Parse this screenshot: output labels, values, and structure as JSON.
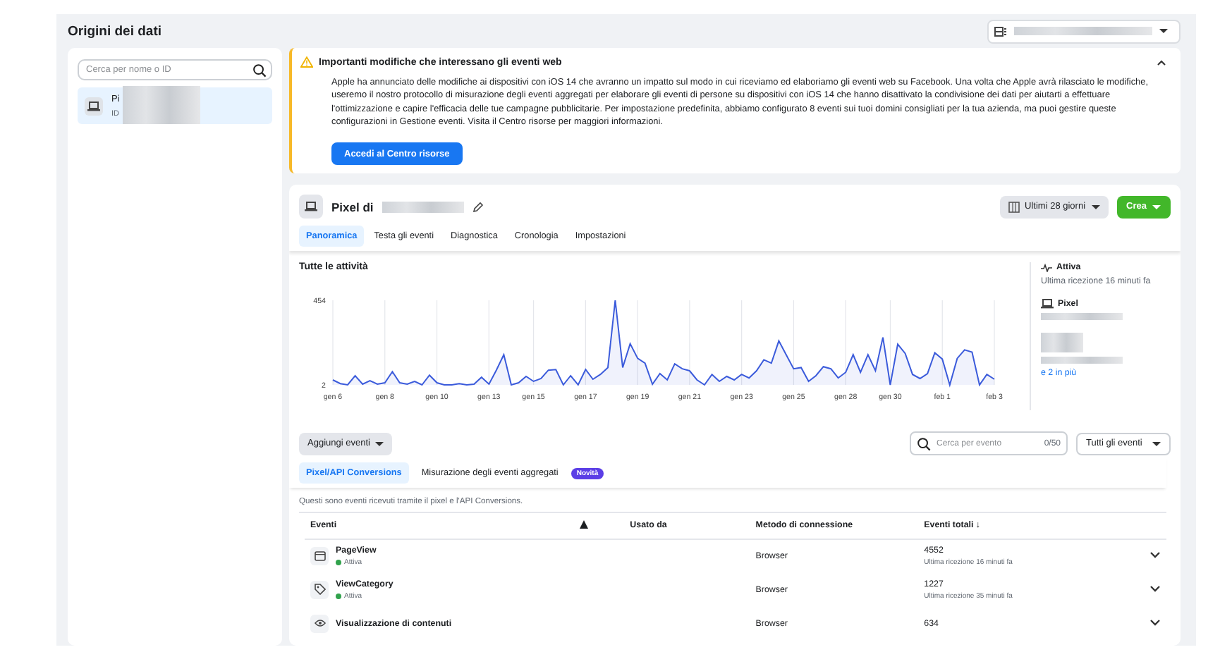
{
  "header": {
    "title": "Origini dei dati"
  },
  "sidebar": {
    "search": {
      "placeholder": "Cerca per nome o ID"
    },
    "items": [
      {
        "name": "Pi",
        "id": "ID",
        "selected": true
      }
    ]
  },
  "notice": {
    "title": "Importanti modifiche che interessano gli eventi web",
    "expanded": true,
    "body": "Apple ha annunciato delle modifiche ai dispositivi con iOS 14 che avranno un impatto sul modo in cui riceviamo ed elaboriamo gli eventi web su Facebook. Una volta che Apple avrà rilasciato le modifiche, useremo il nostro protocollo di misurazione degli eventi aggregati per elaborare gli eventi di persone su dispositivi con iOS 14 che hanno disattivato la condivisione dei dati per aiutarti a effettuare l'ottimizzazione e capire l'efficacia delle tue campagne pubblicitarie. Per impostazione predefinita, abbiamo configurato 8 eventi sui tuoi domini consigliati per la tua azienda, ma puoi gestire queste configurazioni in Gestione eventi. Visita il Centro risorse per maggiori informazioni.",
    "button": "Accedi al Centro risorse"
  },
  "pixel": {
    "title": "Pixel di",
    "date_range": "Ultimi 28 giorni",
    "create": "Crea",
    "tabs": [
      {
        "label": "Panoramica",
        "selected": true
      },
      {
        "label": "Testa gli eventi",
        "selected": false
      },
      {
        "label": "Diagnostica",
        "selected": false
      },
      {
        "label": "Cronologia",
        "selected": false
      },
      {
        "label": "Impostazioni",
        "selected": false
      }
    ],
    "activity": {
      "chart_data": {
        "type": "area",
        "title": "Tutte le attività",
        "grid": true,
        "categories": [
          "gen 6",
          null,
          null,
          null,
          null,
          null,
          null,
          "gen 8",
          null,
          null,
          null,
          null,
          null,
          null,
          "gen 10",
          null,
          null,
          null,
          null,
          null,
          null,
          "gen 13",
          null,
          null,
          null,
          null,
          null,
          "gen 15",
          null,
          null,
          null,
          null,
          null,
          null,
          "gen 17",
          null,
          null,
          null,
          null,
          null,
          null,
          "gen 19",
          null,
          null,
          null,
          null,
          null,
          null,
          "gen 21",
          null,
          null,
          null,
          null,
          null,
          null,
          "gen 23",
          null,
          null,
          null,
          null,
          null,
          null,
          "gen 25",
          null,
          null,
          null,
          null,
          null,
          null,
          "gen 28",
          null,
          null,
          null,
          null,
          null,
          "gen 30",
          null,
          null,
          null,
          null,
          null,
          null,
          "feb 1",
          null,
          null,
          null,
          null,
          null,
          null,
          "feb 3"
        ],
        "ylim": [
          2,
          454
        ],
        "yticks": [
          2,
          454
        ],
        "series": [
          {
            "color": "#3b5bdb",
            "values": [
              28,
              9,
              2,
              51,
              6,
              24,
              6,
              13,
              73,
              13,
              6,
              21,
              2,
              54,
              13,
              2,
              2,
              9,
              2,
              6,
              43,
              6,
              80,
              163,
              2,
              13,
              47,
              21,
              36,
              80,
              84,
              2,
              51,
              2,
              84,
              32,
              58,
              95,
              454,
              95,
              222,
              144,
              118,
              6,
              62,
              28,
              114,
              88,
              77,
              28,
              2,
              58,
              21,
              47,
              28,
              58,
              39,
              77,
              136,
              118,
              237,
              163,
              88,
              95,
              21,
              51,
              99,
              88,
              39,
              69,
              163,
              69,
              163,
              77,
              256,
              2,
              219,
              170,
              58,
              36,
              62,
              174,
              140,
              2,
              144,
              189,
              177,
              2,
              58,
              32
            ]
          }
        ]
      }
    },
    "status": {
      "label": "Attiva",
      "last_received": "Ultima ricezione 16 minuti fa",
      "source": "Pixel",
      "more": "e 2 in più"
    }
  },
  "events": {
    "add": "Aggiungi eventi",
    "search": {
      "placeholder": "Cerca per evento",
      "count": "0/50"
    },
    "filter": "Tutti gli eventi",
    "tabs": [
      {
        "label": "Pixel/API Conversions",
        "selected": true
      },
      {
        "label": "Misurazione degli eventi aggregati",
        "badge": "Novità",
        "selected": false
      }
    ],
    "description": "Questi sono eventi ricevuti tramite il pixel e l'API Conversions.",
    "columns": [
      "Eventi",
      "Usato da",
      "Metodo di connessione",
      "Eventi totali ↓"
    ],
    "rows": [
      {
        "kind": "page",
        "name": "PageView",
        "status": "Attiva",
        "color": "#31a24c",
        "method": "Browser",
        "total": "4552",
        "last": "Ultima ricezione 16 minuti fa"
      },
      {
        "kind": "tag",
        "name": "ViewCategory",
        "status": "Attiva",
        "color": "#31a24c",
        "method": "Browser",
        "total": "1227",
        "last": "Ultima ricezione 35 minuti fa"
      },
      {
        "kind": "eye",
        "name": "Visualizzazione di contenuti",
        "method": "Browser",
        "total": "634"
      }
    ]
  }
}
